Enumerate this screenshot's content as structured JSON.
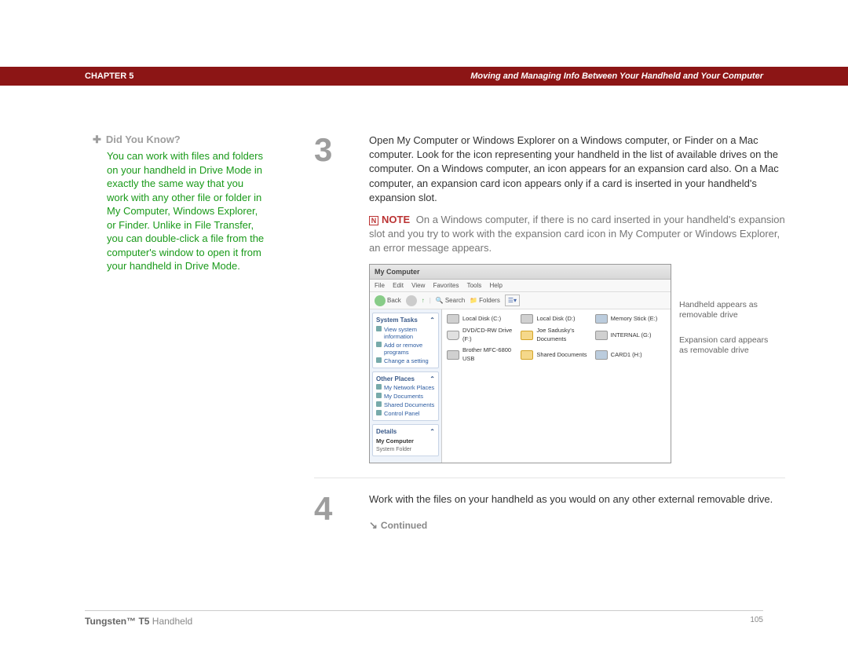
{
  "header": {
    "chapter_label": "CHAPTER 5",
    "title": "Moving and Managing Info Between Your Handheld and Your Computer"
  },
  "sidebar": {
    "dyk_label": "Did You Know?",
    "dyk_body": "You can work with files and folders on your handheld in Drive Mode in exactly the same way that you work with any other file or folder in My Computer, Windows Explorer, or Finder. Unlike in File Transfer, you can double-click a file from the computer's window to open it from your handheld in Drive Mode."
  },
  "steps": [
    {
      "num": "3",
      "body": "Open My Computer or Windows Explorer on a Windows computer, or Finder on a Mac computer. Look for the icon representing your handheld in the list of available drives on the computer. On a Windows computer, an icon appears for an expansion card also. On a Mac computer, an expansion card icon appears only if a card is inserted in your handheld's expansion slot.",
      "note_label": "NOTE",
      "note_body": "On a Windows computer, if there is no card inserted in your handheld's expansion slot and you try to work with the expansion card icon in My Computer or Windows Explorer, an error message appears.",
      "screenshot": {
        "title": "My Computer",
        "menus": [
          "File",
          "Edit",
          "View",
          "Favorites",
          "Tools",
          "Help"
        ],
        "toolbar": {
          "back": "Back",
          "search": "Search",
          "folders": "Folders"
        },
        "panels": [
          {
            "title": "System Tasks",
            "items": [
              "View system information",
              "Add or remove programs",
              "Change a setting"
            ]
          },
          {
            "title": "Other Places",
            "items": [
              "My Network Places",
              "My Documents",
              "Shared Documents",
              "Control Panel"
            ]
          },
          {
            "title": "Details",
            "items": [
              "My Computer",
              "System Folder"
            ]
          }
        ],
        "drives": [
          {
            "label": "Local Disk (C:)",
            "type": "hdd"
          },
          {
            "label": "Local Disk (D:)",
            "type": "hdd"
          },
          {
            "label": "Memory Stick (E:)",
            "type": "card"
          },
          {
            "label": "DVD/CD-RW Drive (F:)",
            "type": "disc"
          },
          {
            "label": "Joe Sadusky's Documents",
            "type": "folder"
          },
          {
            "label": "INTERNAL (G:)",
            "type": "hdd"
          },
          {
            "label": "Brother MFC-6800 USB",
            "type": "hdd"
          },
          {
            "label": "Shared Documents",
            "type": "folder"
          },
          {
            "label": "CARD1 (H:)",
            "type": "card"
          }
        ],
        "callouts": [
          "Handheld appears as removable drive",
          "Expansion card appears as removable drive"
        ]
      }
    },
    {
      "num": "4",
      "body": "Work with the files on your handheld as you would on any other external removable drive.",
      "continued_label": "Continued"
    }
  ],
  "footer": {
    "product_bold": "Tungsten™ T5",
    "product_rest": " Handheld",
    "page": "105"
  }
}
